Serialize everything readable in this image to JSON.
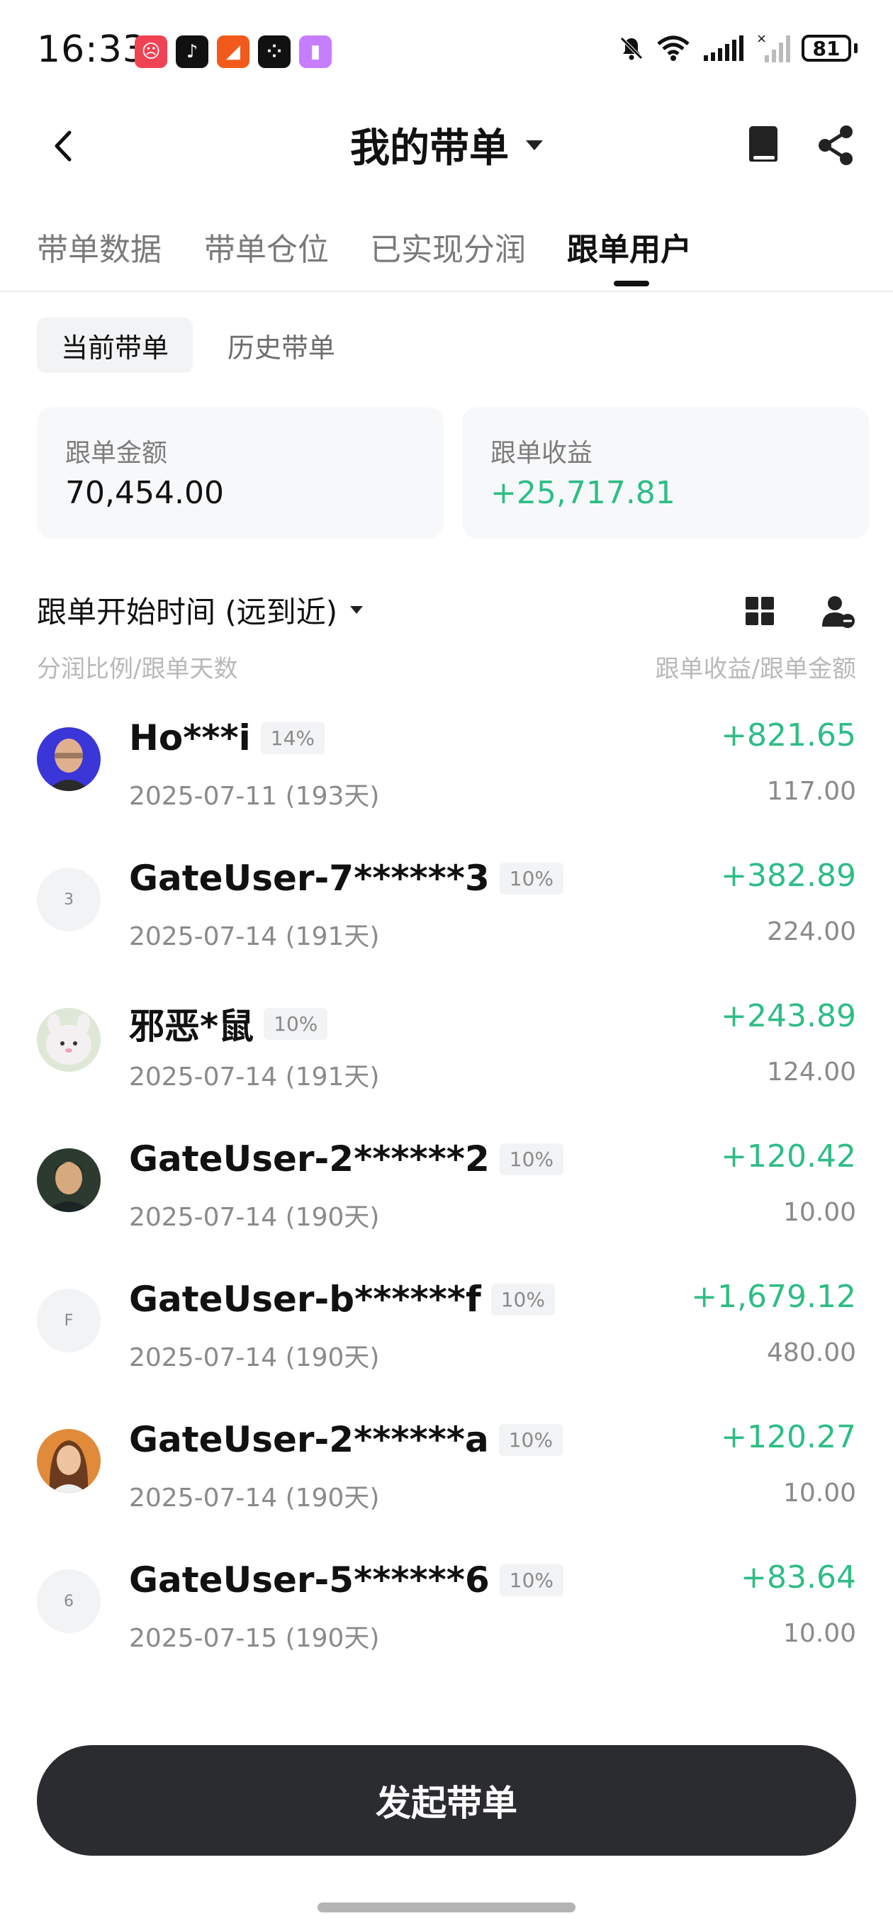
{
  "status_bar": {
    "time": "16:33",
    "battery": "81",
    "app_icons": [
      {
        "name": "app-icon-red",
        "glyph": "☹",
        "color": "#ef4353"
      },
      {
        "name": "tiktok-icon",
        "glyph": "♪",
        "color": "#111111"
      },
      {
        "name": "app-icon-orange",
        "glyph": "◢",
        "color": "#f25a1c"
      },
      {
        "name": "app-icon-dots",
        "glyph": "⁘",
        "color": "#111111"
      },
      {
        "name": "app-icon-gradient",
        "glyph": "▮",
        "color": "#c77dff"
      }
    ]
  },
  "header": {
    "title": "我的带单"
  },
  "tabs": [
    {
      "label": "带单数据",
      "active": false
    },
    {
      "label": "带单仓位",
      "active": false
    },
    {
      "label": "已实现分润",
      "active": false
    },
    {
      "label": "跟单用户",
      "active": true
    }
  ],
  "segment": {
    "current": "当前带单",
    "history": "历史带单"
  },
  "stats": {
    "amount_label": "跟单金额",
    "amount_value": "70,454.00",
    "profit_label": "跟单收益",
    "profit_value": "+25,717.81"
  },
  "sort": {
    "label": "跟单开始时间 (远到近)"
  },
  "columns": {
    "left": "分润比例/跟单天数",
    "right": "跟单收益/跟单金额"
  },
  "users": [
    {
      "name": "Ho***i",
      "ratio": "14%",
      "date": "2025-07-11 (193天)",
      "profit": "+821.65",
      "amount": "117.00",
      "avatar": "photo-bald",
      "avatar_text": ""
    },
    {
      "name": "GateUser-7******3",
      "ratio": "10%",
      "date": "2025-07-14 (191天)",
      "profit": "+382.89",
      "amount": "224.00",
      "avatar": "text",
      "avatar_text": "3"
    },
    {
      "name": "邪恶*鼠",
      "ratio": "10%",
      "date": "2025-07-14 (191天)",
      "profit": "+243.89",
      "amount": "124.00",
      "avatar": "photo-plush",
      "avatar_text": ""
    },
    {
      "name": "GateUser-2******2",
      "ratio": "10%",
      "date": "2025-07-14 (190天)",
      "profit": "+120.42",
      "amount": "10.00",
      "avatar": "photo-man",
      "avatar_text": ""
    },
    {
      "name": "GateUser-b******f",
      "ratio": "10%",
      "date": "2025-07-14 (190天)",
      "profit": "+1,679.12",
      "amount": "480.00",
      "avatar": "text",
      "avatar_text": "F"
    },
    {
      "name": "GateUser-2******a",
      "ratio": "10%",
      "date": "2025-07-14 (190天)",
      "profit": "+120.27",
      "amount": "10.00",
      "avatar": "photo-woman",
      "avatar_text": ""
    },
    {
      "name": "GateUser-5******6",
      "ratio": "10%",
      "date": "2025-07-15 (190天)",
      "profit": "+83.64",
      "amount": "10.00",
      "avatar": "text",
      "avatar_text": "6"
    }
  ],
  "cta": {
    "label": "发起带单"
  },
  "colors": {
    "positive": "#2ebd85",
    "button_bg": "#2b2c30"
  }
}
